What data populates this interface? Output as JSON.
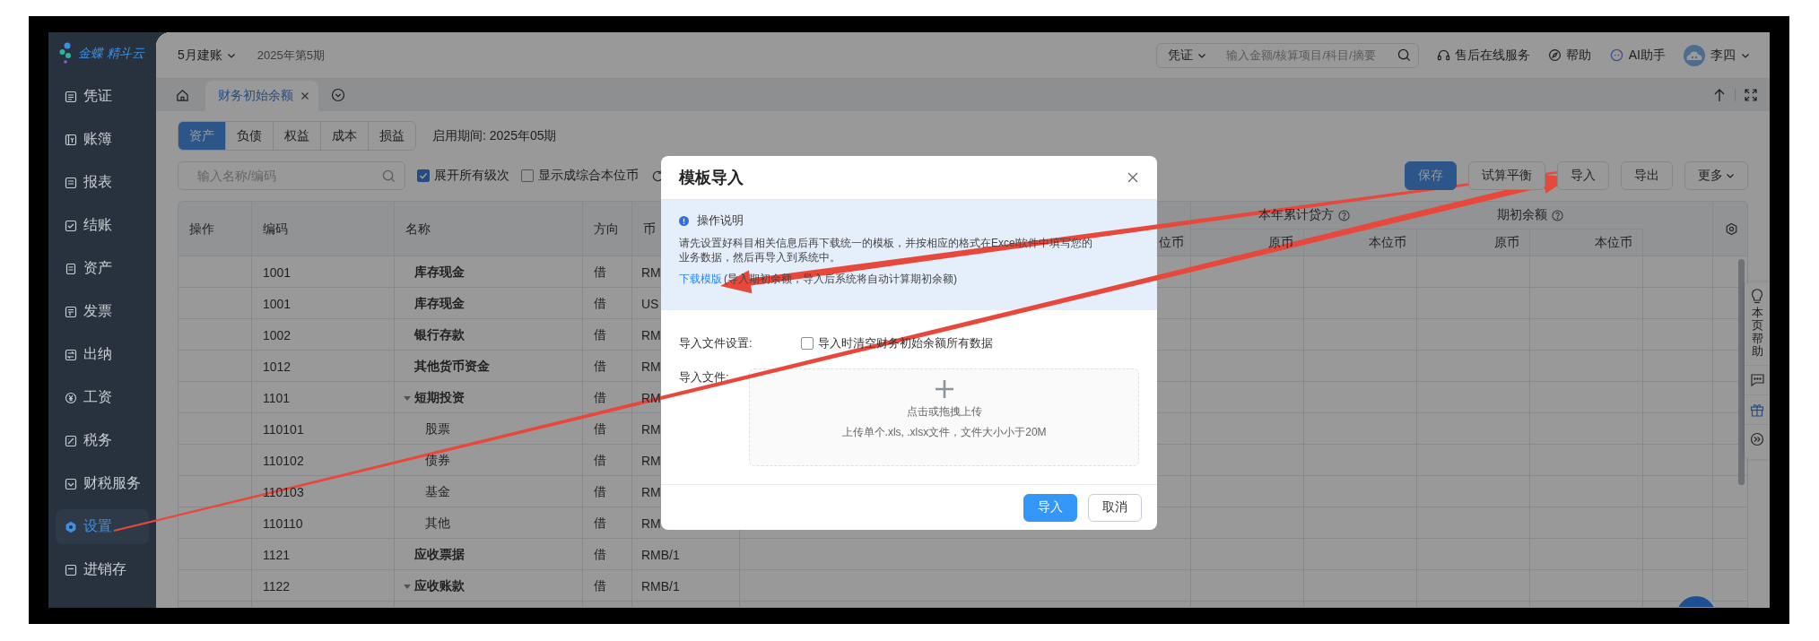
{
  "logo": {
    "text": "金蝶 精斗云"
  },
  "sidebar": {
    "items": [
      {
        "label": "凭证",
        "selected": false
      },
      {
        "label": "账簿",
        "selected": false
      },
      {
        "label": "报表",
        "selected": false
      },
      {
        "label": "结账",
        "selected": false
      },
      {
        "label": "资产",
        "selected": false
      },
      {
        "label": "发票",
        "selected": false
      },
      {
        "label": "出纳",
        "selected": false
      },
      {
        "label": "工资",
        "selected": false
      },
      {
        "label": "税务",
        "selected": false
      },
      {
        "label": "财税服务",
        "selected": false
      },
      {
        "label": "设置",
        "selected": true
      },
      {
        "label": "进销存",
        "selected": false
      }
    ]
  },
  "header": {
    "book": "5月建账",
    "period": "2025年第5期",
    "search": {
      "scope": "凭证",
      "placeholder": "输入金额/核算项目/科目/摘要"
    },
    "links": [
      "售后在线服务",
      "帮助",
      "AI助手"
    ],
    "user": "李四"
  },
  "page_tabs": [
    {
      "label": "财务初始余额",
      "selected": true
    }
  ],
  "category_tabs": [
    {
      "label": "资产",
      "selected": true
    },
    {
      "label": "负债",
      "selected": false
    },
    {
      "label": "权益",
      "selected": false
    },
    {
      "label": "成本",
      "selected": false
    },
    {
      "label": "损益",
      "selected": false
    }
  ],
  "enable_period": "启用期间: 2025年05期",
  "filter": {
    "placeholder": "输入名称/编码",
    "options": [
      {
        "label": "展开所有级次",
        "checked": true
      },
      {
        "label": "显示成综合本位币",
        "checked": false
      }
    ]
  },
  "actions": [
    {
      "label": "保存",
      "kind": "primary"
    },
    {
      "label": "试算平衡",
      "kind": "plain"
    },
    {
      "label": "导入",
      "kind": "plain"
    },
    {
      "label": "导出",
      "kind": "plain"
    },
    {
      "label": "更多",
      "kind": "menu"
    }
  ],
  "table": {
    "columns": [
      "操作",
      "编码",
      "名称",
      "方向",
      "币"
    ],
    "partial_subcolumn": "位币",
    "column_groups": [
      {
        "label": "本年累计贷方",
        "subcolumns": [
          "原币",
          "本位币"
        ]
      },
      {
        "label": "期初余额",
        "subcolumns": [
          "原币",
          "本位币"
        ]
      }
    ],
    "rows": [
      {
        "kind": "account",
        "code": "1001",
        "name": "库存现金",
        "direction": "借",
        "currency": "RM"
      },
      {
        "kind": "account",
        "code": "1001",
        "name": "库存现金",
        "direction": "借",
        "currency": "US"
      },
      {
        "kind": "account",
        "code": "1002",
        "name": "银行存款",
        "direction": "借",
        "currency": "RM"
      },
      {
        "kind": "account",
        "code": "1012",
        "name": "其他货币资金",
        "direction": "借",
        "currency": "RM"
      },
      {
        "kind": "group",
        "expanded": true,
        "code": "1101",
        "name": "短期投资",
        "direction": "借",
        "currency": "RM",
        "children": [
          {
            "kind": "account",
            "code": "110101",
            "name": "股票",
            "direction": "借",
            "currency": "RM"
          },
          {
            "kind": "account",
            "code": "110102",
            "name": "债券",
            "direction": "借",
            "currency": "RM"
          },
          {
            "kind": "account",
            "code": "110103",
            "name": "基金",
            "direction": "借",
            "currency": "RM"
          },
          {
            "kind": "account",
            "code": "110110",
            "name": "其他",
            "direction": "借",
            "currency": "RM"
          }
        ]
      },
      {
        "kind": "account",
        "code": "1121",
        "name": "应收票据",
        "direction": "借",
        "currency": "RMB/1"
      },
      {
        "kind": "group",
        "expanded": true,
        "code": "1122",
        "name": "应收账款",
        "direction": "借",
        "currency": "RMB/1"
      }
    ]
  },
  "help_rail": {
    "label": "本页帮助"
  },
  "dialog": {
    "title": "模板导入",
    "notice": {
      "title": "操作说明",
      "text": "请先设置好科目相关信息后再下载统一的模板，并按相应的格式在Excel软件中填写您的业务数据，然后再导入到系统中。",
      "link": "下载模版",
      "note": "(导入期初余额，导入后系统将自动计算期初余额)"
    },
    "settings_label": "导入文件设置:",
    "clear_option": {
      "label": "导入时清空财务初始余额所有数据",
      "checked": false
    },
    "file_label": "导入文件:",
    "upload": {
      "prompt": "点击或拖拽上传",
      "hint": "上传单个.xls, .xlsx文件，文件大小小于20M"
    },
    "buttons": [
      {
        "label": "导入",
        "kind": "primary"
      },
      {
        "label": "取消",
        "kind": "plain"
      }
    ]
  }
}
